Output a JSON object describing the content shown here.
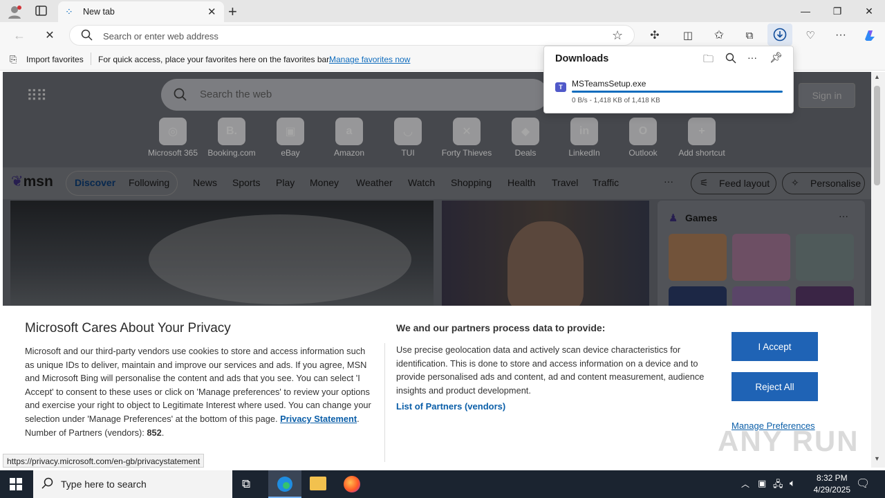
{
  "browser": {
    "tab_title": "New tab",
    "omnibox_placeholder": "Search or enter web address",
    "favorites_bar": {
      "import_label": "Import favorites",
      "hint_text": "For quick access, place your favorites here on the favorites bar.",
      "manage_link": "Manage favorites now"
    }
  },
  "downloads": {
    "title": "Downloads",
    "item": {
      "filename": "MSTeamsSetup.exe",
      "status": "0 B/s - 1,418 KB of 1,418 KB",
      "progress_fraction": 1.0
    }
  },
  "newtab": {
    "search_placeholder": "Search the web",
    "sign_in": "Sign in",
    "shortcuts": [
      {
        "label": "Microsoft 365",
        "icon": "m365-icon",
        "glyph": "◎"
      },
      {
        "label": "Booking.com",
        "icon": "booking-icon",
        "glyph": "B."
      },
      {
        "label": "eBay",
        "icon": "ebay-icon",
        "glyph": "▣"
      },
      {
        "label": "Amazon",
        "icon": "amazon-icon",
        "glyph": "a"
      },
      {
        "label": "TUI",
        "icon": "tui-icon",
        "glyph": "◡"
      },
      {
        "label": "Forty Thieves",
        "icon": "forty-thieves-icon",
        "glyph": "✕"
      },
      {
        "label": "Deals",
        "icon": "deals-icon",
        "glyph": "◆"
      },
      {
        "label": "LinkedIn",
        "icon": "linkedin-icon",
        "glyph": "in"
      },
      {
        "label": "Outlook",
        "icon": "outlook-icon",
        "glyph": "O"
      },
      {
        "label": "Add shortcut",
        "icon": "plus-icon",
        "glyph": "+"
      }
    ],
    "msn_logo": "msn",
    "nav": {
      "discover": "Discover",
      "following": "Following",
      "links": [
        "News",
        "Sports",
        "Play",
        "Money",
        "Weather",
        "Watch",
        "Shopping",
        "Health",
        "Travel",
        "Traffic"
      ],
      "more": "···",
      "feed_layout": "Feed layout",
      "personalise": "Personalise"
    },
    "games_title": "Games"
  },
  "privacy": {
    "title": "Microsoft Cares About Your Privacy",
    "body": "Microsoft and our third-party vendors use cookies to store and access information such as unique IDs to deliver, maintain and improve our services and ads. If you agree, MSN and Microsoft Bing will personalise the content and ads that you see. You can select 'I Accept' to consent to these uses or click on 'Manage preferences' to review your options and exercise your right to object to Legitimate Interest where used.  You can change your selection under 'Manage Preferences' at the bottom of this page.",
    "privacy_link": "Privacy Statement",
    "partners_label": "Number of Partners (vendors):",
    "partners_count": "852",
    "right_title": "We and our partners process data to provide:",
    "right_body": "Use precise geolocation data and actively scan device characteristics for identification. This is done to store and access information on a device and to provide personalised ads and content, ad and content measurement, audience insights and product development.",
    "partners_link": "List of Partners (vendors)",
    "accept": "I Accept",
    "reject": "Reject All",
    "manage": "Manage Preferences"
  },
  "status_url": "https://privacy.microsoft.com/en-gb/privacystatement",
  "watermark": "ANY RUN",
  "taskbar": {
    "search_placeholder": "Type here to search",
    "time": "8:32 PM",
    "date": "4/29/2025"
  }
}
